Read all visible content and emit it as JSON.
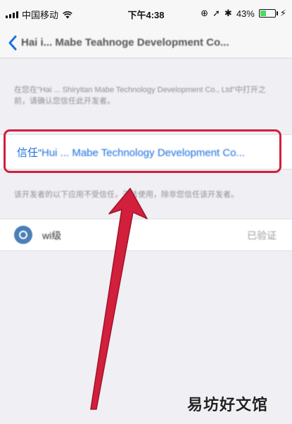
{
  "status_bar": {
    "carrier": "中国移动",
    "time": "下午4:38",
    "battery_percent": "43%",
    "battery_level": 0.43,
    "battery_color": "#4cd964"
  },
  "nav": {
    "back_icon": "chevron-left-icon",
    "title": "Hai i... Mabe Teahnoge Development Co..."
  },
  "description": "在您在\"Hai ... Shiryitan Mabe Technology Development Co., Ltd\"中打开之前，请确认您信任此开发者。",
  "trust": {
    "prefix": "信任“",
    "rest": "Hui ... Mabe Technology Development Co..."
  },
  "note": "该开发者的以下应用不受信任，无法使用，除非您信任该开发者。",
  "app": {
    "name": "wi级",
    "status": "已验证"
  },
  "watermark": "易坊好文馆",
  "colors": {
    "highlight": "#d11f3c",
    "link": "#1b6fe0",
    "arrow": "#d11f3c"
  }
}
